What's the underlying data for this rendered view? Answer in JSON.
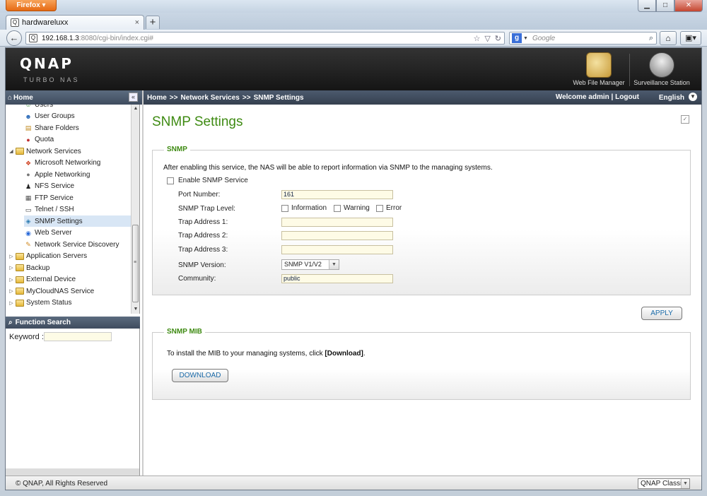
{
  "browser": {
    "menu_label": "Firefox",
    "win_min": "▁",
    "win_max": "□",
    "win_close": "✕",
    "tab_title": "hardwareluxx",
    "tab_close": "×",
    "tab_favicon": "Q",
    "new_tab": "+",
    "url_host": "192.168.1.3",
    "url_rest": ":8080/cgi-bin/index.cgi#",
    "search_placeholder": "Google",
    "back_glyph": "←",
    "star_glyph": "☆",
    "dropdown_glyph": "▽",
    "reload_glyph": "↻",
    "search_go_glyph": "⌕",
    "home_glyph": "⌂",
    "addon_glyph": "▣▾"
  },
  "header": {
    "logo": "QNAP",
    "sub": "TURBO NAS",
    "apps": [
      {
        "label": "Web File Manager"
      },
      {
        "label": "Surveillance Station"
      }
    ]
  },
  "topbar": {
    "home": "Home",
    "collapse": "«",
    "crumbs": [
      "Home",
      "Network Services",
      "SNMP Settings"
    ],
    "crumb_sep": ">>",
    "welcome": "Welcome admin | Logout",
    "language": "English"
  },
  "sidebar": {
    "items": [
      {
        "label": "Users",
        "icon": "users-icon",
        "glyph": "☺",
        "color": "#3a8a3a"
      },
      {
        "label": "User Groups",
        "icon": "user-groups-icon",
        "glyph": "☻",
        "color": "#2a6ab8"
      },
      {
        "label": "Share Folders",
        "icon": "share-folders-icon",
        "glyph": "▤",
        "color": "#c08a20"
      },
      {
        "label": "Quota",
        "icon": "quota-icon",
        "glyph": "●",
        "color": "#c03030"
      },
      {
        "label": "Network Services",
        "icon": "folder-icon",
        "folder": true,
        "expanded": true
      },
      {
        "label": "Microsoft Networking",
        "icon": "microsoft-networking-icon",
        "glyph": "❖",
        "color": "#d04020"
      },
      {
        "label": "Apple Networking",
        "icon": "apple-networking-icon",
        "glyph": "●",
        "color": "#777"
      },
      {
        "label": "NFS Service",
        "icon": "nfs-service-icon",
        "glyph": "♟",
        "color": "#222"
      },
      {
        "label": "FTP Service",
        "icon": "ftp-service-icon",
        "glyph": "▦",
        "color": "#555"
      },
      {
        "label": "Telnet / SSH",
        "icon": "telnet-ssh-icon",
        "glyph": "▭",
        "color": "#333"
      },
      {
        "label": "SNMP Settings",
        "icon": "snmp-settings-icon",
        "glyph": "◈",
        "color": "#2a7ab0",
        "selected": true
      },
      {
        "label": "Web Server",
        "icon": "web-server-icon",
        "glyph": "◉",
        "color": "#2a6ad8"
      },
      {
        "label": "Network Service Discovery",
        "icon": "network-discovery-icon",
        "glyph": "✎",
        "color": "#d08820"
      },
      {
        "label": "Application Servers",
        "icon": "folder-icon",
        "folder": true
      },
      {
        "label": "Backup",
        "icon": "folder-icon",
        "folder": true
      },
      {
        "label": "External Device",
        "icon": "folder-icon",
        "folder": true
      },
      {
        "label": "MyCloudNAS Service",
        "icon": "folder-icon",
        "folder": true
      },
      {
        "label": "System Status",
        "icon": "folder-icon",
        "folder": true
      }
    ],
    "function_search_title": "Function Search",
    "keyword_label": "Keyword :"
  },
  "main": {
    "title": "SNMP Settings",
    "snmp": {
      "legend": "SNMP",
      "description": "After enabling this service, the NAS will be able to report information via SNMP to the managing systems.",
      "enable_label": "Enable SNMP Service",
      "port_label": "Port Number:",
      "port_value": "161",
      "trap_level_label": "SNMP Trap Level:",
      "trap_levels": [
        "Information",
        "Warning",
        "Error"
      ],
      "trap1_label": "Trap Address 1:",
      "trap2_label": "Trap Address 2:",
      "trap3_label": "Trap Address 3:",
      "version_label": "SNMP Version:",
      "version_value": "SNMP V1/V2",
      "community_label": "Community:",
      "community_value": "public"
    },
    "apply": "APPLY",
    "mib": {
      "legend": "SNMP MIB",
      "description_pre": "To install the MIB to your managing systems, click ",
      "description_link": "[Download]",
      "description_post": ".",
      "download": "DOWNLOAD"
    }
  },
  "statusbar": {
    "copyright": "© QNAP, All Rights Reserved",
    "theme": "QNAP Classic"
  },
  "colors": {
    "accent_green": "#3e8a12",
    "link_blue": "#1a6aa8",
    "input_bg": "#fefbe6"
  }
}
